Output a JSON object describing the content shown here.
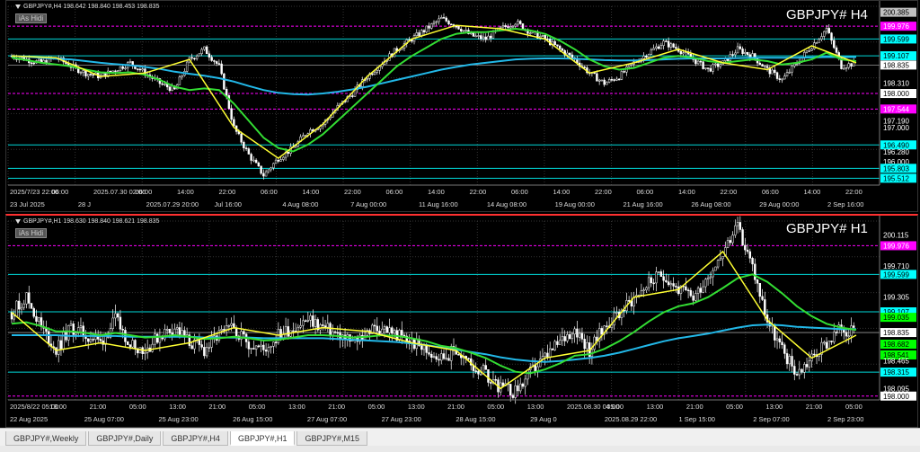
{
  "panels": [
    {
      "id": "h4",
      "header": "GBPJPY#,H4  198.642 198.840 198.453 198.835",
      "title": "GBPJPY#  H4",
      "button": "iAs Hidi",
      "top": 0,
      "height": 236,
      "ylim": [
        195.31,
        200.56
      ],
      "price_labels": [
        {
          "value": "200.385",
          "color": "#c0c0c0",
          "text": "#000"
        },
        {
          "value": "199.976",
          "color": "#ff00ff",
          "text": "#fff"
        },
        {
          "value": "199.599",
          "color": "#00ffff",
          "text": "#000"
        },
        {
          "value": "199.107",
          "color": "#00ffff",
          "text": "#000"
        },
        {
          "value": "198.835",
          "color": "#ffffff",
          "text": "#000"
        },
        {
          "value": "198.310",
          "color": "none",
          "text": "#fff"
        },
        {
          "value": "198.000",
          "color": "#ffffff",
          "text": "#000"
        },
        {
          "value": "197.544",
          "color": "#ff00ff",
          "text": "#fff"
        },
        {
          "value": "197.190",
          "color": "none",
          "text": "#fff"
        },
        {
          "value": "197.000",
          "color": "none",
          "text": "#fff"
        },
        {
          "value": "196.490",
          "color": "#00ffff",
          "text": "#000"
        },
        {
          "value": "196.280",
          "color": "none",
          "text": "#fff"
        },
        {
          "value": "196.000",
          "color": "none",
          "text": "#fff"
        },
        {
          "value": "195.803",
          "color": "#00ffff",
          "text": "#000"
        },
        {
          "value": "195.512",
          "color": "#00ffff",
          "text": "#000"
        }
      ],
      "time_labels": [
        "2025/7/23 22:00",
        "06:00",
        "2025.07.30 02:00",
        "06:00",
        "14:00",
        "22:00",
        "06:00",
        "14:00",
        "22:00",
        "06:00",
        "14:00",
        "22:00",
        "06:00",
        "14:00",
        "22:00",
        "06:00",
        "14:00",
        "22:00",
        "06:00",
        "14:00",
        "22:00"
      ],
      "time_labels2": [
        "23 Jul 2025",
        "28 J",
        "2025.07.29 20:00",
        "Jul 16:00",
        "4 Aug 08:00",
        "7 Aug 00:00",
        "11 Aug 16:00",
        "14 Aug 08:00",
        "19 Aug 00:00",
        "21 Aug 16:00",
        "26 Aug 08:00",
        "29 Aug 00:00",
        "2 Sep 16:00"
      ]
    },
    {
      "id": "h1",
      "header": "GBPJPY#,H1  198.630 198.840 198.621 198.835",
      "title": "GBPJPY#  H1",
      "button": "iAs Hidi",
      "top": 238,
      "height": 238,
      "ylim": [
        197.95,
        200.3
      ],
      "price_labels": [
        {
          "value": "200.115",
          "color": "none",
          "text": "#fff"
        },
        {
          "value": "199.976",
          "color": "#ff00ff",
          "text": "#fff"
        },
        {
          "value": "199.710",
          "color": "none",
          "text": "#fff"
        },
        {
          "value": "199.599",
          "color": "#00ffff",
          "text": "#000"
        },
        {
          "value": "199.305",
          "color": "none",
          "text": "#fff"
        },
        {
          "value": "199.107",
          "color": "#00ffff",
          "text": "#000"
        },
        {
          "value": "199.035",
          "color": "#00ff00",
          "text": "#000"
        },
        {
          "value": "198.835",
          "color": "#ffffff",
          "text": "#000"
        },
        {
          "value": "198.682",
          "color": "#00ff00",
          "text": "#000"
        },
        {
          "value": "198.541",
          "color": "#00ff00",
          "text": "#000"
        },
        {
          "value": "198.465",
          "color": "none",
          "text": "#fff"
        },
        {
          "value": "198.315",
          "color": "#00ffff",
          "text": "#000"
        },
        {
          "value": "198.095",
          "color": "none",
          "text": "#fff"
        },
        {
          "value": "198.000",
          "color": "#ffffff",
          "text": "#000"
        }
      ],
      "time_labels": [
        "2025/8/22 05:00",
        "13:00",
        "21:00",
        "05:00",
        "13:00",
        "21:00",
        "05:00",
        "13:00",
        "21:00",
        "05:00",
        "13:00",
        "21:00",
        "05:00",
        "13:00",
        "2025.08.30 04:00",
        "05:00",
        "13:00",
        "21:00",
        "05:00",
        "13:00",
        "21:00",
        "05:00"
      ],
      "time_labels2": [
        "22 Aug 2025",
        "25 Aug 07:00",
        "25 Aug 23:00",
        "26 Aug 15:00",
        "27 Aug 07:00",
        "27 Aug 23:00",
        "28 Aug 15:00",
        "29 Aug 0",
        "2025.08.29 22:00",
        "1 Sep 15:00",
        "2 Sep 07:00",
        "2 Sep 23:00"
      ]
    }
  ],
  "tabs": [
    "GBPJPY#,Weekly",
    "GBPJPY#,Daily",
    "GBPJPY#,H4",
    "GBPJPY#,H1",
    "GBPJPY#,M15"
  ],
  "active_tab": "GBPJPY#,H1",
  "chart_data": [
    {
      "type": "candlestick",
      "title": "GBPJPY#  H4",
      "ylim": [
        195.31,
        200.56
      ],
      "levels": {
        "magenta": [
          199.976,
          198.0,
          197.544
        ],
        "cyan": [
          199.599,
          199.107,
          196.49,
          195.803,
          195.512
        ],
        "white": [
          198.835
        ]
      },
      "price_path": [
        199.1,
        199.0,
        198.9,
        199.05,
        198.8,
        198.6,
        198.5,
        198.7,
        198.9,
        198.6,
        198.3,
        198.1,
        199.0,
        199.3,
        198.8,
        197.0,
        196.2,
        195.6,
        196.1,
        196.4,
        196.9,
        197.1,
        197.6,
        198.0,
        198.5,
        198.9,
        199.3,
        199.6,
        199.9,
        200.2,
        200.0,
        199.7,
        199.6,
        199.9,
        200.1,
        199.8,
        199.6,
        199.3,
        199.0,
        198.6,
        198.3,
        198.5,
        198.9,
        199.2,
        199.5,
        199.3,
        199.0,
        198.7,
        198.9,
        199.3,
        199.1,
        198.7,
        198.4,
        198.9,
        199.4,
        199.9,
        198.8,
        198.9
      ],
      "ma_fast": [
        199.05,
        198.98,
        198.9,
        198.85,
        198.8,
        198.7,
        198.62,
        198.6,
        198.62,
        198.55,
        198.4,
        198.2,
        198.1,
        198.15,
        198.1,
        197.7,
        197.2,
        196.7,
        196.4,
        196.3,
        196.5,
        196.8,
        197.2,
        197.6,
        198.0,
        198.4,
        198.8,
        199.1,
        199.35,
        199.6,
        199.75,
        199.8,
        199.8,
        199.85,
        199.9,
        199.85,
        199.75,
        199.55,
        199.3,
        199.0,
        198.8,
        198.7,
        198.75,
        198.9,
        199.05,
        199.1,
        199.05,
        198.95,
        198.9,
        198.95,
        199.0,
        198.95,
        198.85,
        198.9,
        199.0,
        199.2,
        199.0,
        198.95
      ],
      "ma_slow": [
        199.1,
        199.08,
        199.05,
        199.02,
        199.0,
        198.95,
        198.9,
        198.86,
        198.83,
        198.78,
        198.72,
        198.64,
        198.58,
        198.52,
        198.45,
        198.35,
        198.22,
        198.1,
        198.02,
        197.98,
        197.97,
        198.0,
        198.05,
        198.12,
        198.2,
        198.3,
        198.4,
        198.5,
        198.6,
        198.7,
        198.78,
        198.85,
        198.9,
        198.95,
        199.0,
        199.02,
        199.03,
        199.03,
        199.02,
        199.0,
        198.98,
        198.97,
        198.97,
        198.98,
        199.0,
        199.02,
        199.03,
        199.03,
        199.03,
        199.04,
        199.05,
        199.05,
        199.05,
        199.05,
        199.06,
        199.07,
        199.07,
        199.07
      ]
    },
    {
      "type": "candlestick",
      "title": "GBPJPY#  H1",
      "ylim": [
        197.95,
        200.3
      ],
      "levels": {
        "magenta": [
          199.976,
          198.0
        ],
        "cyan": [
          199.599,
          199.107,
          198.315
        ],
        "white": [
          198.835
        ]
      },
      "price_path": [
        199.1,
        199.3,
        198.9,
        198.6,
        198.9,
        198.8,
        198.7,
        199.0,
        198.7,
        198.6,
        198.8,
        198.9,
        198.7,
        198.6,
        198.8,
        198.9,
        198.7,
        198.6,
        198.8,
        198.9,
        199.0,
        198.9,
        198.8,
        198.7,
        198.85,
        198.9,
        198.8,
        198.7,
        198.6,
        198.5,
        198.6,
        198.4,
        198.3,
        198.1,
        198.05,
        198.3,
        198.5,
        198.7,
        198.9,
        198.6,
        198.9,
        199.1,
        199.3,
        199.5,
        199.6,
        199.4,
        199.3,
        199.6,
        199.9,
        200.2,
        199.7,
        199.0,
        198.6,
        198.3,
        198.5,
        198.7,
        198.9,
        198.8
      ],
      "ma_fast": [
        198.95,
        198.97,
        198.92,
        198.85,
        198.85,
        198.83,
        198.8,
        198.83,
        198.8,
        198.77,
        198.78,
        198.8,
        198.78,
        198.75,
        198.76,
        198.78,
        198.76,
        198.73,
        198.74,
        198.77,
        198.8,
        198.8,
        198.79,
        198.77,
        198.78,
        198.8,
        198.79,
        198.76,
        198.72,
        198.66,
        198.63,
        198.57,
        198.5,
        198.4,
        198.32,
        198.3,
        198.35,
        198.43,
        198.53,
        198.55,
        198.62,
        198.72,
        198.84,
        198.98,
        199.1,
        199.18,
        199.22,
        199.3,
        199.42,
        199.55,
        199.6,
        199.5,
        199.35,
        199.18,
        199.05,
        198.95,
        198.9,
        198.87
      ],
      "ma_slow": [
        198.8,
        198.8,
        198.8,
        198.8,
        198.79,
        198.79,
        198.79,
        198.79,
        198.78,
        198.78,
        198.78,
        198.78,
        198.78,
        198.77,
        198.77,
        198.77,
        198.77,
        198.76,
        198.76,
        198.76,
        198.76,
        198.76,
        198.75,
        198.74,
        198.73,
        198.72,
        198.71,
        198.69,
        198.67,
        198.64,
        198.61,
        198.58,
        198.55,
        198.51,
        198.48,
        198.46,
        198.45,
        198.46,
        198.48,
        198.5,
        198.53,
        198.57,
        198.62,
        198.67,
        198.72,
        198.76,
        198.79,
        198.82,
        198.86,
        198.9,
        198.93,
        198.94,
        198.93,
        198.91,
        198.9,
        198.89,
        198.88,
        198.88
      ]
    }
  ]
}
